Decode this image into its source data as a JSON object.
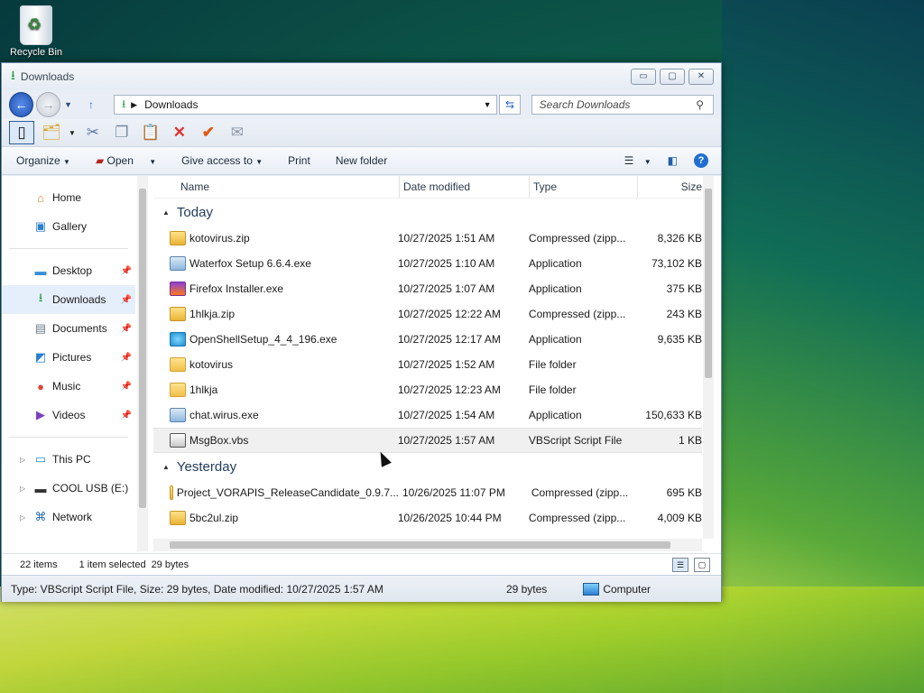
{
  "desktop": {
    "recycle_bin_label": "Recycle Bin"
  },
  "window": {
    "title": "Downloads",
    "controls": {
      "minimize": "▭",
      "maximize": "▢",
      "close": "✕"
    }
  },
  "address": {
    "location": "Downloads",
    "search_placeholder": "Search Downloads"
  },
  "commands": {
    "organize": "Organize",
    "open": "Open",
    "give_access": "Give access to",
    "print": "Print",
    "new_folder": "New folder",
    "help": "?"
  },
  "sidebar": {
    "quick": [
      {
        "label": "Home",
        "icon": "home-icon"
      },
      {
        "label": "Gallery",
        "icon": "gallery-icon"
      }
    ],
    "pinned": [
      {
        "label": "Desktop",
        "icon": "desktop-icon"
      },
      {
        "label": "Downloads",
        "icon": "downloads-icon",
        "selected": true
      },
      {
        "label": "Documents",
        "icon": "documents-icon"
      },
      {
        "label": "Pictures",
        "icon": "pictures-icon"
      },
      {
        "label": "Music",
        "icon": "music-icon"
      },
      {
        "label": "Videos",
        "icon": "videos-icon"
      }
    ],
    "devices": [
      {
        "label": "This PC",
        "icon": "computer-icon"
      },
      {
        "label": "COOL USB (E:)",
        "icon": "usb-drive-icon"
      },
      {
        "label": "Network",
        "icon": "network-icon"
      }
    ]
  },
  "columns": {
    "name": "Name",
    "date": "Date modified",
    "type": "Type",
    "size": "Size"
  },
  "groups": [
    {
      "label": "Today",
      "files": [
        {
          "name": "kotovirus.zip",
          "date": "10/27/2025 1:51 AM",
          "type": "Compressed (zipp...",
          "size": "8,326 KB",
          "icon": "zip"
        },
        {
          "name": "Waterfox Setup 6.6.4.exe",
          "date": "10/27/2025 1:10 AM",
          "type": "Application",
          "size": "73,102 KB",
          "icon": "app"
        },
        {
          "name": "Firefox Installer.exe",
          "date": "10/27/2025 1:07 AM",
          "type": "Application",
          "size": "375 KB",
          "icon": "ff"
        },
        {
          "name": "1hlkja.zip",
          "date": "10/27/2025 12:22 AM",
          "type": "Compressed (zipp...",
          "size": "243 KB",
          "icon": "zip"
        },
        {
          "name": "OpenShellSetup_4_4_196.exe",
          "date": "10/27/2025 12:17 AM",
          "type": "Application",
          "size": "9,635 KB",
          "icon": "os"
        },
        {
          "name": "kotovirus",
          "date": "10/27/2025 1:52 AM",
          "type": "File folder",
          "size": "",
          "icon": "folder"
        },
        {
          "name": "1hlkja",
          "date": "10/27/2025 12:23 AM",
          "type": "File folder",
          "size": "",
          "icon": "folder"
        },
        {
          "name": "chat.wirus.exe",
          "date": "10/27/2025 1:54 AM",
          "type": "Application",
          "size": "150,633 KB",
          "icon": "app"
        },
        {
          "name": "MsgBox.vbs",
          "date": "10/27/2025 1:57 AM",
          "type": "VBScript Script File",
          "size": "1 KB",
          "icon": "vbs",
          "selected": true
        }
      ]
    },
    {
      "label": "Yesterday",
      "files": [
        {
          "name": "Project_VORAPIS_ReleaseCandidate_0.9.7...",
          "date": "10/26/2025 11:07 PM",
          "type": "Compressed (zipp...",
          "size": "695 KB",
          "icon": "zip"
        },
        {
          "name": "5bc2ul.zip",
          "date": "10/26/2025 10:44 PM",
          "type": "Compressed (zipp...",
          "size": "4,009 KB",
          "icon": "zip"
        }
      ]
    }
  ],
  "status": {
    "items": "22 items",
    "selected": "1 item selected",
    "selected_size": "29 bytes",
    "details": "Type: VBScript Script File, Size: 29 bytes, Date modified: 10/27/2025 1:57 AM",
    "size_right": "29 bytes",
    "location": "Computer"
  }
}
